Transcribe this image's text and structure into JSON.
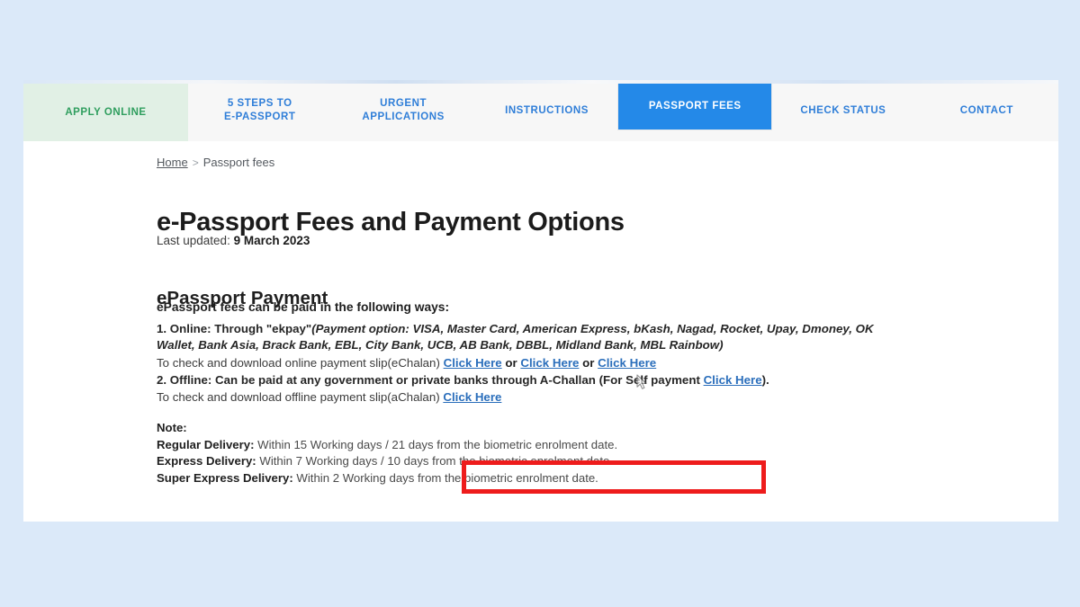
{
  "nav": {
    "tabs": [
      {
        "label": "APPLY ONLINE",
        "state": "apply"
      },
      {
        "label_line1": "5 STEPS TO",
        "label_line2": "e-PASSPORT",
        "state": "plain"
      },
      {
        "label_line1": "URGENT",
        "label_line2": "APPLICATIONS",
        "state": "plain"
      },
      {
        "label": "INSTRUCTIONS",
        "state": "plain"
      },
      {
        "label": "PASSPORT FEES",
        "state": "active"
      },
      {
        "label": "CHECK STATUS",
        "state": "plain"
      },
      {
        "label": "CONTACT",
        "state": "plain"
      }
    ],
    "colors": {
      "apply_bg": "#e1f0e5",
      "apply_text": "#2f9e5e",
      "active_bg": "#2489e8",
      "active_text": "#ffffff",
      "link_text": "#2f7ed8",
      "bar_bg": "#f7f7f7"
    }
  },
  "breadcrumb": {
    "home": "Home",
    "separator": ">",
    "current": "Passport fees"
  },
  "page": {
    "title": "e-Passport Fees and Payment Options",
    "last_updated_label": "Last updated:",
    "last_updated_value": "9 March 2023",
    "section_title": "ePassport Payment",
    "intro": "ePassport fees can be paid in the following ways:"
  },
  "online": {
    "prefix": "1. Online: Through \"ekpay\"",
    "italic_detail": "(Payment option: VISA, Master Card, American Express, bKash, Nagad, Rocket, Upay, Dmoney, OK Wallet, Bank Asia, Brack Bank, EBL, City Bank, UCB, AB Bank, DBBL, Midland Bank, MBL Rainbow)"
  },
  "echalan": {
    "text": "To check and download online payment slip(eChalan)",
    "link1": "Click Here",
    "or1": "or",
    "link2": "Click Here",
    "or2": "or",
    "link3": "Click Here"
  },
  "offline": {
    "text_before": "2. Offline: Can be paid at any government or private banks through A-Challan (For Self payment",
    "link": "Click Here",
    "text_after": ")."
  },
  "achalan": {
    "text": "To check and download offline payment slip(aChalan)",
    "link": "Click Here"
  },
  "note": {
    "heading": "Note:",
    "rows": [
      {
        "label": "Regular Delivery:",
        "value": "Within 15 Working days / 21 days from the biometric enrolment date."
      },
      {
        "label": "Express Delivery:",
        "value": "Within 7 Working days / 10 days from the biometric enrolment date."
      },
      {
        "label": "Super Express Delivery:",
        "value": "Within 2 Working days from the biometric enrolment date."
      }
    ]
  },
  "annotation": {
    "highlight_color": "#ee1c1c",
    "shape": "rectangle"
  },
  "background": {
    "outer_color": "#dbe9f9",
    "page_color": "#ffffff"
  }
}
